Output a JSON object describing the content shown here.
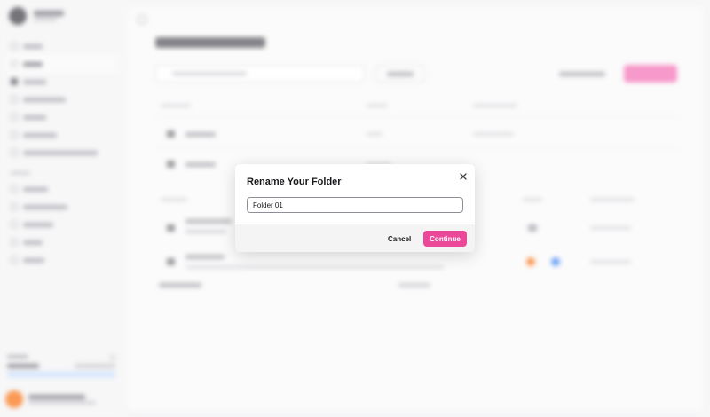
{
  "dialog": {
    "title": "Rename Your Folder",
    "input_value": "Folder 01",
    "cancel_label": "Cancel",
    "continue_label": "Continue",
    "close_icon": "close-icon",
    "accent_color": "#ec4899"
  },
  "background": {
    "sidebar_nav_icons": [
      "home-icon",
      "pages-icon",
      "agents-icon",
      "folder-icon",
      "integrations-icon",
      "history-icon"
    ],
    "status_colors": [
      "#f97316",
      "#3b82f6"
    ]
  }
}
